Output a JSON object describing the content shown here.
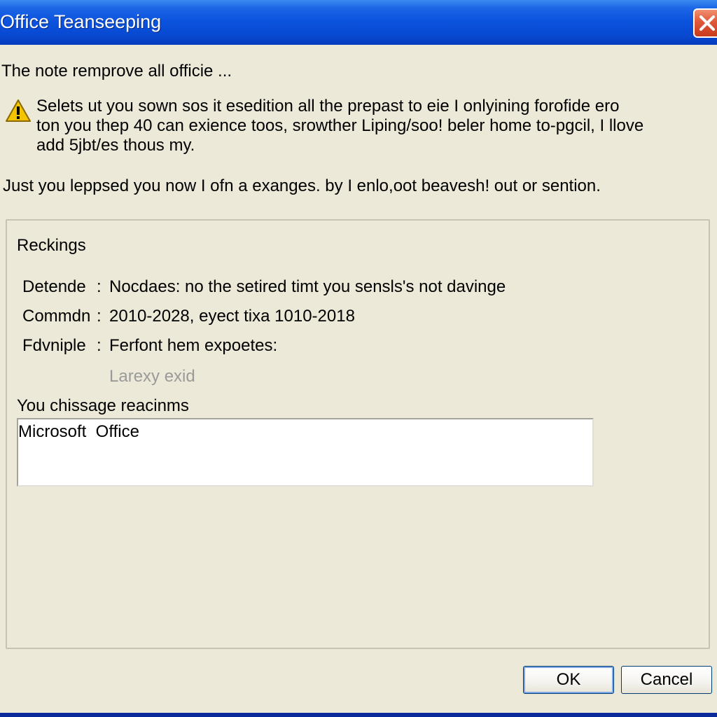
{
  "window": {
    "title": "Office Teanseeping"
  },
  "dialog": {
    "intro": "The note remprove all officie ...",
    "warning_icon": "warning-triangle-icon",
    "warning_lines": [
      "Selets ut you sown sos it esedition all the prepast to eie I onlyining forofide ero",
      "ton you thep 40 can exience toos, srowther Liping/soo! beler home to-pgcil, I llove",
      "add 5jbt/es thous my."
    ],
    "note": "Just you leppsed you now I ofn a exanges. by I enlo,oot beavesh! out or sention."
  },
  "details": {
    "group_title": "Reckings",
    "rows": [
      {
        "label": "Detende",
        "separator": ":",
        "value": "Nocdaes: no the setired timt you sensls's not davinge"
      },
      {
        "label": "Commdn",
        "separator": ":",
        "value": "2010-2028, eyect tixa 1010-2018"
      },
      {
        "label": "Fdvniple",
        "separator": ":",
        "value": "Ferfont hem expoetes:"
      }
    ],
    "disabled_link": "Larexy exid",
    "choose_label": "You  chissage reacinms",
    "textbox_value": "Microsoft  Office"
  },
  "buttons": {
    "ok": "OK",
    "cancel": "Cancel"
  },
  "colors": {
    "titlebar": "#0a52dc",
    "dialog_bg": "#ece9d8",
    "close_button": "#e0583a",
    "disabled_text": "#9a9a9a"
  }
}
